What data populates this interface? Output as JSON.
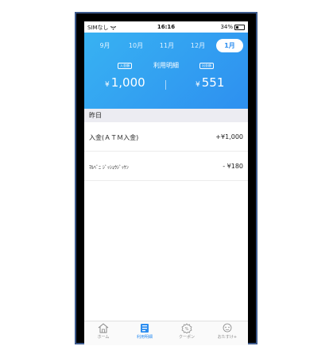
{
  "status_bar": {
    "carrier": "SIMなし",
    "time": "16:16",
    "battery": "34%"
  },
  "months": [
    {
      "label": "9月",
      "active": false
    },
    {
      "label": "10月",
      "active": false
    },
    {
      "label": "11月",
      "active": false
    },
    {
      "label": "12月",
      "active": false
    },
    {
      "label": "1月",
      "active": true
    }
  ],
  "summary": {
    "title": "利用明細",
    "deposit_tag": "入金額",
    "withdraw_tag": "出金額",
    "currency": "¥",
    "deposit_amount": "1,000",
    "withdraw_amount": "551"
  },
  "section": {
    "label": "昨日"
  },
  "transactions": [
    {
      "name": "入金(ＡＴＭ入金)",
      "amount": "+¥1,000"
    },
    {
      "name": "ﾏﾙﾍﾞﾆ ｼﾞｯｼｮｳｼﾞｯｹﾝ",
      "amount": "- ¥180"
    }
  ],
  "tabs": [
    {
      "label": "ホーム",
      "icon": "home-icon",
      "active": false
    },
    {
      "label": "利用明細",
      "icon": "statement-icon",
      "active": true
    },
    {
      "label": "クーポン",
      "icon": "coupon-icon",
      "active": false
    },
    {
      "label": "おたすけ+",
      "icon": "help-icon",
      "active": false
    }
  ],
  "colors": {
    "accent": "#2d8ef0",
    "header_start": "#38b2f2",
    "section_bg": "#ececf2"
  }
}
